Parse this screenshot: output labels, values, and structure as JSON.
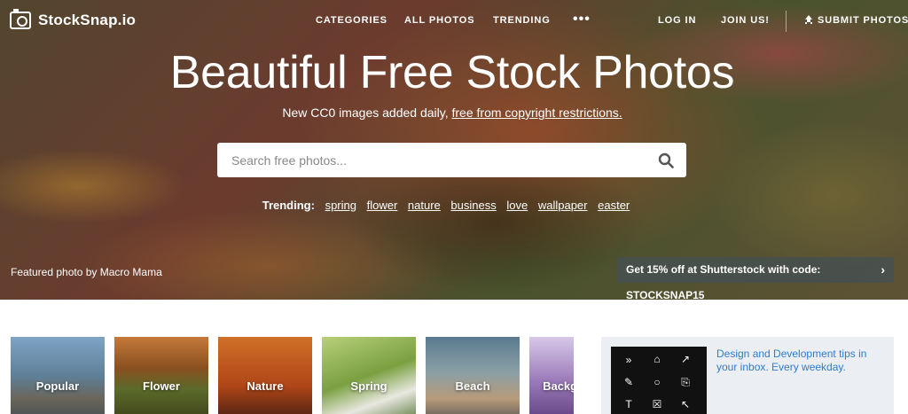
{
  "brand": {
    "name": "StockSnap.io"
  },
  "nav": {
    "categories": "CATEGORIES",
    "all_photos": "ALL PHOTOS",
    "trending": "TRENDING",
    "more": "•••",
    "login": "LOG IN",
    "join": "JOIN US!",
    "submit": "SUBMIT PHOTOS"
  },
  "hero": {
    "title": "Beautiful Free Stock Photos",
    "subtitle_prefix": "New CC0 images added daily, ",
    "subtitle_link": "free from copyright restrictions."
  },
  "search": {
    "placeholder": "Search free photos..."
  },
  "trending": {
    "label": "Trending:",
    "tags": [
      "spring",
      "flower",
      "nature",
      "business",
      "love",
      "wallpaper",
      "easter"
    ]
  },
  "featured": {
    "prefix": "Featured photo by ",
    "author": "Macro Mama"
  },
  "promo": {
    "text": "Get 15% off at Shutterstock with code: STOCKSNAP15",
    "chevron": "›"
  },
  "categories": [
    "Popular",
    "Flower",
    "Nature",
    "Spring",
    "Beach",
    "Background"
  ],
  "ad": {
    "text": "Design and Development tips in your inbox. Every weekday.",
    "icons": [
      "»",
      "⌂",
      "↗",
      "✎",
      "○",
      "⎘",
      "T",
      "☒",
      "↖"
    ]
  },
  "colors": {
    "link_blue": "#2e7bcf",
    "promo_bg": "#46504f",
    "ad_bg": "#ebeff3"
  }
}
